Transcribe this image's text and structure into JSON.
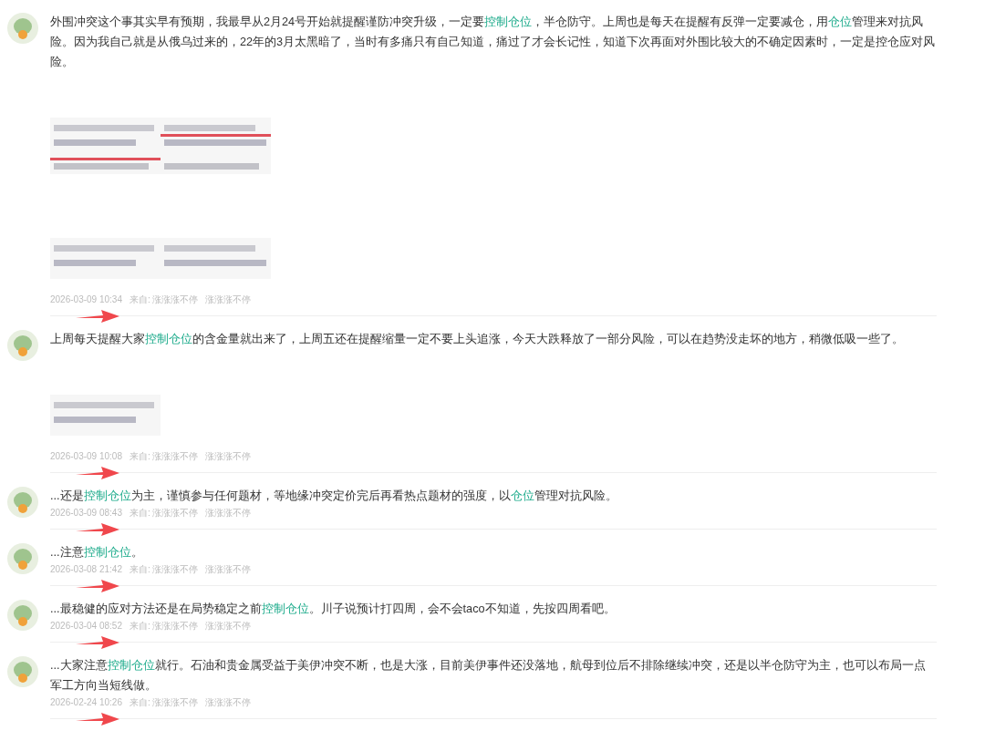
{
  "posts": [
    {
      "segments": [
        {
          "kind": "plain",
          "text": "外围冲突这个事其实早有预期，我最早从2月24号开始就提醒谨防冲突升级，一定要"
        },
        {
          "kind": "link",
          "text": "控制仓位"
        },
        {
          "kind": "plain",
          "text": "，半仓防守。上周也是每天在提醒有反弹一定要减仓，用"
        },
        {
          "kind": "link",
          "text": "仓位"
        },
        {
          "kind": "plain",
          "text": "管理来对抗风险。因为我自己就是从俄乌过来的，22年的3月太黑暗了，当时有多痛只有自己知道，痛过了才会长记性，知道下次再面对外围比较大的不确定因素时，一定是控仓应对风险。"
        }
      ],
      "image_rows": [
        [
          {
            "kind": "picture"
          },
          {
            "kind": "picture"
          }
        ],
        [
          {
            "kind": "picture"
          },
          {
            "kind": "picture"
          }
        ]
      ],
      "time": "2026-03-09 10:34",
      "source_label": "来自:",
      "source": "涨涨涨不停",
      "author": "涨涨涨不停",
      "arrow": true
    },
    {
      "segments": [
        {
          "kind": "plain",
          "text": "上周每天提醒大家"
        },
        {
          "kind": "link",
          "text": "控制仓位"
        },
        {
          "kind": "plain",
          "text": "的含金量就出来了，上周五还在提醒缩量一定不要上头追涨，今天大跌释放了一部分风险，可以在趋势没走坏的地方，稍微低吸一些了。"
        }
      ],
      "image_rows": [
        [
          {
            "kind": "picture"
          }
        ]
      ],
      "time": "2026-03-09 10:08",
      "source_label": "来自:",
      "source": "涨涨涨不停",
      "author": "涨涨涨不停",
      "arrow": true
    },
    {
      "segments": [
        {
          "kind": "plain",
          "text": "...还是"
        },
        {
          "kind": "link",
          "text": "控制仓位"
        },
        {
          "kind": "plain",
          "text": "为主，谨慎参与任何题材，等地缘冲突定价完后再看热点题材的强度，以"
        },
        {
          "kind": "link",
          "text": "仓位"
        },
        {
          "kind": "plain",
          "text": "管理对抗风险。"
        }
      ],
      "time": "2026-03-09 08:43",
      "source_label": "来自:",
      "source": "涨涨涨不停",
      "author": "涨涨涨不停",
      "arrow": true
    },
    {
      "segments": [
        {
          "kind": "plain",
          "text": "...注意"
        },
        {
          "kind": "link",
          "text": "控制仓位"
        },
        {
          "kind": "plain",
          "text": "。"
        }
      ],
      "time": "2026-03-08 21:42",
      "source_label": "来自:",
      "source": "涨涨涨不停",
      "author": "涨涨涨不停",
      "arrow": true
    },
    {
      "segments": [
        {
          "kind": "plain",
          "text": "...最稳健的应对方法还是在局势稳定之前"
        },
        {
          "kind": "link",
          "text": "控制仓位"
        },
        {
          "kind": "plain",
          "text": "。川子说预计打四周，会不会taco不知道，先按四周看吧。"
        }
      ],
      "time": "2026-03-04 08:52",
      "source_label": "来自:",
      "source": "涨涨涨不停",
      "author": "涨涨涨不停",
      "arrow": true
    },
    {
      "segments": [
        {
          "kind": "plain",
          "text": "...大家注意"
        },
        {
          "kind": "link",
          "text": "控制仓位"
        },
        {
          "kind": "plain",
          "text": "就行。石油和贵金属受益于美伊冲突不断，也是大涨，目前美伊事件还没落地，航母到位后不排除继续冲突，还是以半仓防守为主，也可以布局一点军工方向当短线做。"
        }
      ],
      "time": "2026-02-24 10:26",
      "source_label": "来自:",
      "source": "涨涨涨不停",
      "author": "涨涨涨不停",
      "arrow": true
    }
  ]
}
